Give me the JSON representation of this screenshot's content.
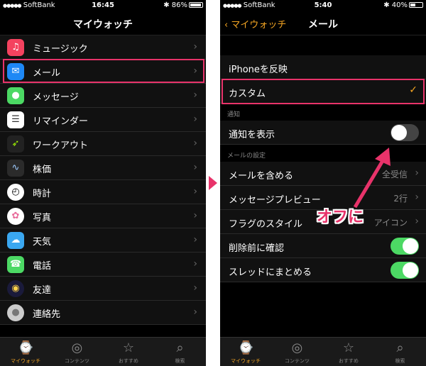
{
  "left": {
    "status": {
      "carrier": "SoftBank",
      "time": "16:45",
      "battery": "86%",
      "battery_level": 0.86
    },
    "nav_title": "マイウォッチ",
    "items": [
      {
        "label": "ミュージック",
        "icon": "music-icon",
        "color": "#f4425f"
      },
      {
        "label": "メール",
        "icon": "mail-icon",
        "color": "#1e88f5"
      },
      {
        "label": "メッセージ",
        "icon": "message-icon",
        "color": "#4cd964"
      },
      {
        "label": "リマインダー",
        "icon": "reminder-icon",
        "color": "#ffffff"
      },
      {
        "label": "ワークアウト",
        "icon": "workout-icon",
        "color": "#222222"
      },
      {
        "label": "株価",
        "icon": "stocks-icon",
        "color": "#2b2b2b"
      },
      {
        "label": "時計",
        "icon": "clock-icon",
        "color": "#ffffff"
      },
      {
        "label": "写真",
        "icon": "photos-icon",
        "color": "#ffffff"
      },
      {
        "label": "天気",
        "icon": "weather-icon",
        "color": "#3aa7f0"
      },
      {
        "label": "電話",
        "icon": "phone-icon",
        "color": "#4cd964"
      },
      {
        "label": "友達",
        "icon": "friends-icon",
        "color": "#1a1a3a"
      },
      {
        "label": "連絡先",
        "icon": "contacts-icon",
        "color": "#cccccc"
      }
    ],
    "tabs": [
      {
        "label": "マイウォッチ",
        "icon": "watch-icon",
        "active": true
      },
      {
        "label": "コンテンツ",
        "icon": "compass-icon",
        "active": false
      },
      {
        "label": "おすすめ",
        "icon": "star-icon",
        "active": false
      },
      {
        "label": "検索",
        "icon": "search-icon",
        "active": false
      }
    ]
  },
  "right": {
    "status": {
      "carrier": "SoftBank",
      "time": "5:40",
      "battery": "40%",
      "battery_level": 0.4
    },
    "back_label": "マイウォッチ",
    "nav_title": "メール",
    "mirror_label": "iPhoneを反映",
    "custom_label": "カスタム",
    "notification_section": "通知",
    "show_notifications_label": "通知を表示",
    "show_notifications_on": false,
    "mail_settings_section": "メールの設定",
    "settings": [
      {
        "label": "メールを含める",
        "value": "全受信",
        "type": "chevron"
      },
      {
        "label": "メッセージプレビュー",
        "value": "2行",
        "type": "chevron"
      },
      {
        "label": "フラグのスタイル",
        "value": "アイコン",
        "type": "chevron"
      },
      {
        "label": "削除前に確認",
        "value": "",
        "type": "toggle",
        "on": true
      },
      {
        "label": "スレッドにまとめる",
        "value": "",
        "type": "toggle",
        "on": true
      }
    ],
    "tabs": [
      {
        "label": "マイウォッチ",
        "icon": "watch-icon",
        "active": true
      },
      {
        "label": "コンテンツ",
        "icon": "compass-icon",
        "active": false
      },
      {
        "label": "おすすめ",
        "icon": "star-icon",
        "active": false
      },
      {
        "label": "検索",
        "icon": "search-icon",
        "active": false
      }
    ]
  },
  "annotation": {
    "text": "オフに",
    "color": "#e8336a"
  }
}
